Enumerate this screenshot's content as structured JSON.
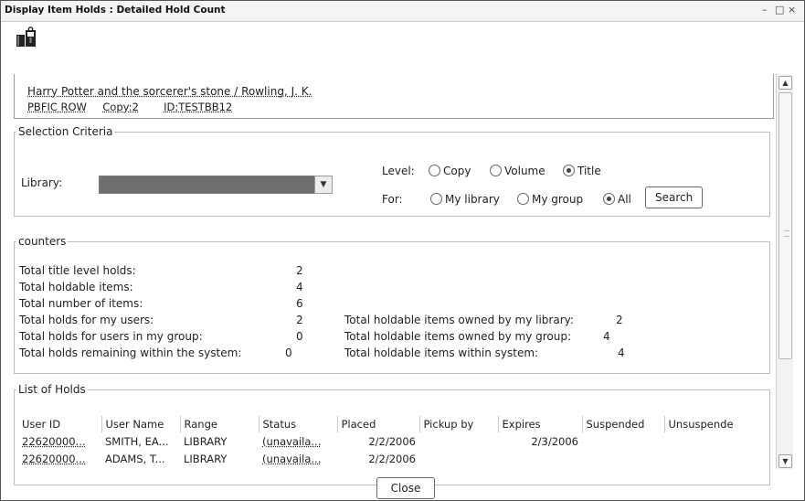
{
  "window": {
    "title": "Display Item Holds : Detailed Hold Count",
    "minimize": "–",
    "maximize": "□",
    "close": "×"
  },
  "item": {
    "title_author": "Harry Potter and the sorcerer's stone / Rowling, J. K.",
    "call_number": "PBFIC ROW",
    "copy": "Copy:2",
    "id": "ID:TESTBB12"
  },
  "selection": {
    "legend": "Selection Criteria",
    "library_label": "Library:",
    "library_value": "",
    "level_label": "Level:",
    "level_options": [
      "Copy",
      "Volume",
      "Title"
    ],
    "level_selected": "Title",
    "for_label": "For:",
    "for_options": [
      "My library",
      "My group",
      "All"
    ],
    "for_selected": "All",
    "search_button": "Search"
  },
  "counters": {
    "legend": "counters",
    "left": [
      {
        "label": "Total title level holds:",
        "value": "2"
      },
      {
        "label": "Total holdable items:",
        "value": "4"
      },
      {
        "label": "Total number of items:",
        "value": "6"
      },
      {
        "label": "Total holds for my users:",
        "value": "2"
      },
      {
        "label": "Total holds for users in my group:",
        "value": "0"
      },
      {
        "label": "Total holds remaining within the system:",
        "value": "0"
      }
    ],
    "right": [
      {
        "label": "Total holdable items owned by my library:",
        "value": "2"
      },
      {
        "label": "Total holdable items owned by my group:",
        "value": "4"
      },
      {
        "label": "Total holdable items within system:",
        "value": "4"
      }
    ]
  },
  "holds": {
    "legend": "List of Holds",
    "columns": [
      "User ID",
      "User Name",
      "Range",
      "Status",
      "Placed",
      "Pickup by",
      "Expires",
      "Suspended",
      "Unsuspende"
    ],
    "rows": [
      {
        "user_id": "22620000...",
        "user_name": "SMITH, EA...",
        "range": "LIBRARY",
        "status": "(unavaila...",
        "placed": "2/2/2006",
        "pickup_by": "",
        "expires": "2/3/2006",
        "suspended": "",
        "unsuspend": ""
      },
      {
        "user_id": "22620000...",
        "user_name": "ADAMS, T...",
        "range": "LIBRARY",
        "status": "(unavaila...",
        "placed": "2/2/2006",
        "pickup_by": "",
        "expires": "",
        "suspended": "",
        "unsuspend": ""
      }
    ]
  },
  "footer": {
    "close_button": "Close"
  },
  "icons": {
    "toolbar": "hold-item-icon",
    "scroll_up": "chevron-up-icon",
    "scroll_down": "chevron-down-icon",
    "dropdown": "chevron-down-icon"
  }
}
